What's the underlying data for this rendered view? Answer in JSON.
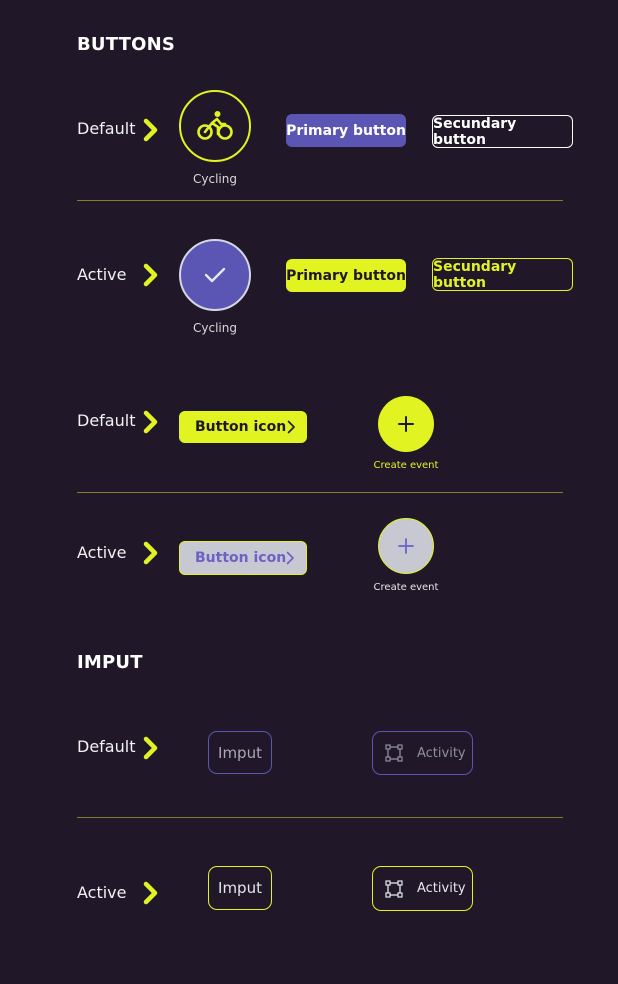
{
  "colors": {
    "background": "#201829",
    "accent_lime": "#e1f321",
    "accent_purple": "#5b56b3",
    "divider": "#7d7f33",
    "inactive_grey": "#c8c8d2"
  },
  "buttons_section": {
    "title": "BUTTONS",
    "rows": [
      {
        "state": "Default"
      },
      {
        "state": "Active"
      },
      {
        "state": "Default"
      },
      {
        "state": "Active"
      }
    ],
    "cycling_label": "Cycling",
    "primary_label": "Primary button",
    "secondary_label": "Secundary button",
    "button_icon_label": "Button icon",
    "create_event_label": "Create event",
    "icons": {
      "bicycle": "bicycle-icon",
      "check": "check-icon",
      "chevron": "chevron-right-icon",
      "plus": "plus-icon"
    }
  },
  "input_section": {
    "title": "IMPUT",
    "rows": [
      {
        "state": "Default"
      },
      {
        "state": "Active"
      }
    ],
    "input_label": "Imput",
    "activity_label": "Activity",
    "icons": {
      "activity": "select-frame-icon"
    }
  }
}
